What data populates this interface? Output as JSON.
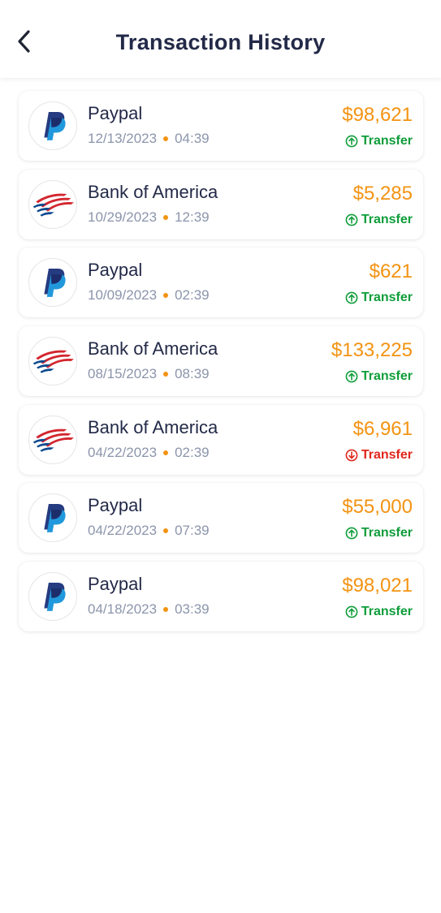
{
  "header": {
    "title": "Transaction History",
    "back_icon": "chevron-left-icon"
  },
  "colors": {
    "amount": "#f39312",
    "transfer_in": "#0f9d3a",
    "transfer_out": "#e0261c",
    "title": "#232a48",
    "meta": "#8b95ab"
  },
  "transactions": [
    {
      "name": "Paypal",
      "logo": "paypal-logo-icon",
      "date": "12/13/2023",
      "time": "04:39",
      "amount": "$98,621",
      "status": "Transfer",
      "direction": "in"
    },
    {
      "name": "Bank of America",
      "logo": "bank-of-america-logo-icon",
      "date": "10/29/2023",
      "time": "12:39",
      "amount": "$5,285",
      "status": "Transfer",
      "direction": "in"
    },
    {
      "name": "Paypal",
      "logo": "paypal-logo-icon",
      "date": "10/09/2023",
      "time": "02:39",
      "amount": "$621",
      "status": "Transfer",
      "direction": "in"
    },
    {
      "name": "Bank of America",
      "logo": "bank-of-america-logo-icon",
      "date": "08/15/2023",
      "time": "08:39",
      "amount": "$133,225",
      "status": "Transfer",
      "direction": "in"
    },
    {
      "name": "Bank of America",
      "logo": "bank-of-america-logo-icon",
      "date": "04/22/2023",
      "time": "02:39",
      "amount": "$6,961",
      "status": "Transfer",
      "direction": "out"
    },
    {
      "name": "Paypal",
      "logo": "paypal-logo-icon",
      "date": "04/22/2023",
      "time": "07:39",
      "amount": "$55,000",
      "status": "Transfer",
      "direction": "in"
    },
    {
      "name": "Paypal",
      "logo": "paypal-logo-icon",
      "date": "04/18/2023",
      "time": "03:39",
      "amount": "$98,021",
      "status": "Transfer",
      "direction": "in"
    }
  ]
}
